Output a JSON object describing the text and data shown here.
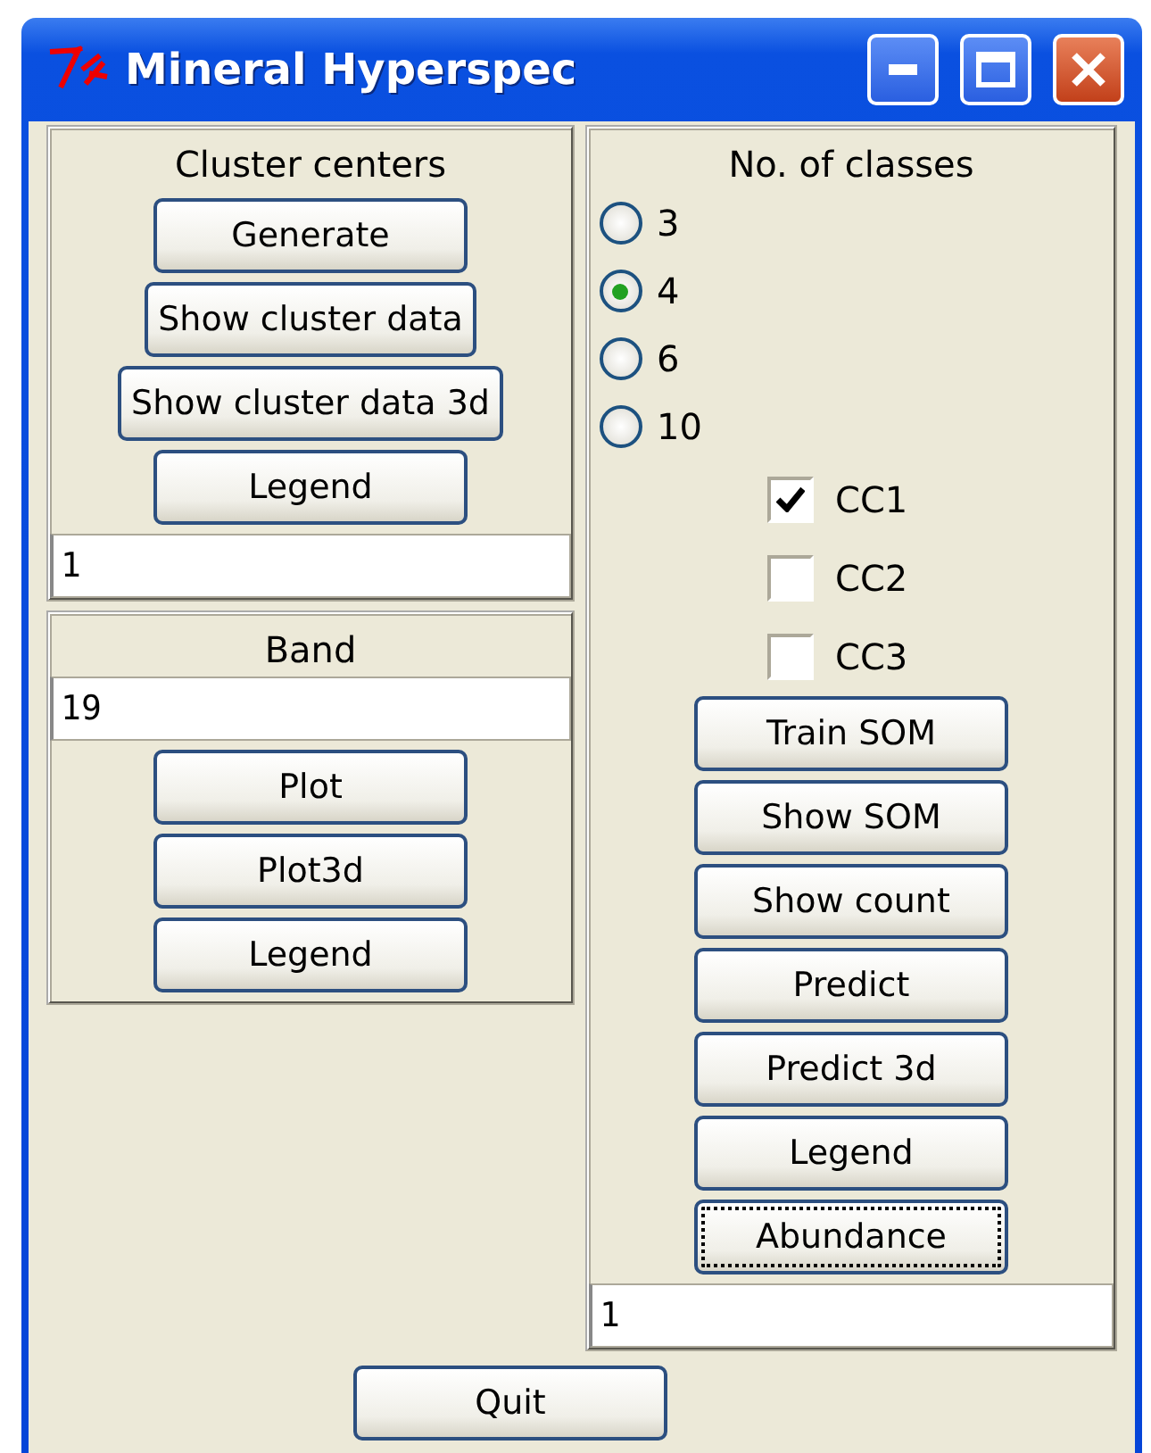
{
  "window": {
    "title": "Mineral Hyperspec"
  },
  "cluster_centers": {
    "label": "Cluster centers",
    "buttons": [
      {
        "label": "Generate",
        "focused": false
      },
      {
        "label": "Show cluster data",
        "focused": false
      },
      {
        "label": "Show cluster data 3d",
        "focused": false
      },
      {
        "label": "Legend",
        "focused": false
      }
    ],
    "entry": {
      "value": "1"
    }
  },
  "band": {
    "label": "Band",
    "entry": {
      "value": "19"
    },
    "buttons": [
      {
        "label": "Plot",
        "focused": false
      },
      {
        "label": "Plot3d",
        "focused": false
      },
      {
        "label": "Legend",
        "focused": false
      }
    ]
  },
  "classes": {
    "label": "No. of classes",
    "options": [
      {
        "label": "3",
        "selected": false
      },
      {
        "label": "4",
        "selected": true
      },
      {
        "label": "6",
        "selected": false
      },
      {
        "label": "10",
        "selected": false
      }
    ],
    "checkboxes": [
      {
        "label": "CC1",
        "checked": true
      },
      {
        "label": "CC2",
        "checked": false
      },
      {
        "label": "CC3",
        "checked": false
      }
    ],
    "buttons": [
      {
        "label": "Train SOM",
        "focused": false
      },
      {
        "label": "Show SOM",
        "focused": false
      },
      {
        "label": "Show count",
        "focused": false
      },
      {
        "label": "Predict",
        "focused": false
      },
      {
        "label": "Predict 3d",
        "focused": false
      },
      {
        "label": "Legend",
        "focused": false
      },
      {
        "label": "Abundance",
        "focused": true
      }
    ],
    "entry": {
      "value": "1"
    }
  },
  "quit": {
    "label": "Quit",
    "focused": false
  }
}
